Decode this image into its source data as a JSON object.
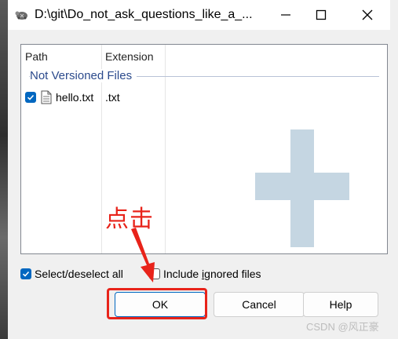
{
  "window": {
    "title": "D:\\git\\Do_not_ask_questions_like_a_...",
    "minimize_icon": "minimize-icon",
    "maximize_icon": "maximize-icon",
    "close_icon": "close-icon"
  },
  "list": {
    "columns": [
      "Path",
      "Extension"
    ],
    "group_label": "Not Versioned Files",
    "rows": [
      {
        "checked": true,
        "path": "hello.txt",
        "extension": ".txt",
        "icon": "text-file-icon"
      }
    ]
  },
  "options": {
    "select_all": {
      "label": "Select/deselect all",
      "checked": true
    },
    "include_ignored": {
      "label_prefix": "Include ",
      "label_underlined": "i",
      "label_suffix": "gnored files",
      "checked": false
    }
  },
  "buttons": {
    "ok": "OK",
    "cancel": "Cancel",
    "help": "Help"
  },
  "annotation": {
    "text": "点击",
    "color": "#e8231a"
  },
  "watermark": "CSDN @风正豪",
  "colors": {
    "accent": "#0067c0",
    "group_label": "#2b4a8c",
    "highlight": "#e8231a"
  }
}
